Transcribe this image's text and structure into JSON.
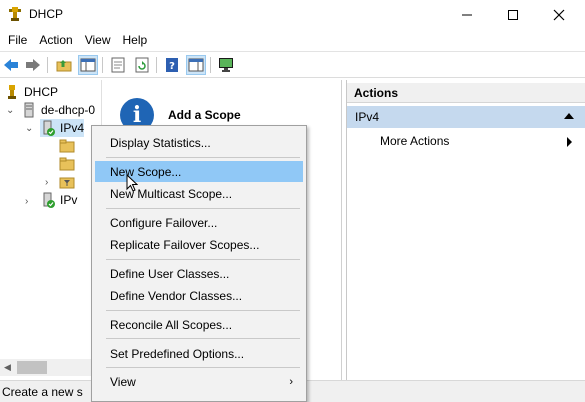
{
  "window": {
    "title": "DHCP",
    "controls": [
      "minimize-icon",
      "maximize-icon",
      "close-icon"
    ]
  },
  "menubar": {
    "items": [
      "File",
      "Action",
      "View",
      "Help"
    ]
  },
  "toolbar": {
    "buttons": [
      "back-arrow-icon",
      "forward-arrow-icon",
      "up-folder-icon",
      "show-hide-tree-icon",
      "properties-icon",
      "refresh-icon",
      "help-icon",
      "show-hide-action-pane-icon",
      "monitor-icon"
    ]
  },
  "tree": {
    "root": "DHCP",
    "server": "de-dhcp-0",
    "ipv4": "IPv4",
    "ipv6": "IPv"
  },
  "middle": {
    "title": "Add a Scope"
  },
  "actions": {
    "header": "Actions",
    "group": "IPv4",
    "item": "More Actions"
  },
  "context_menu": {
    "items": [
      "Display Statistics...",
      "New Scope...",
      "New Multicast Scope...",
      "Configure Failover...",
      "Replicate Failover Scopes...",
      "Define User Classes...",
      "Define Vendor Classes...",
      "Reconcile All Scopes...",
      "Set Predefined Options...",
      "View"
    ],
    "highlighted": "New Scope..."
  },
  "status": {
    "text": "Create a new s"
  },
  "colors": {
    "menu_highlight": "#90c8f6",
    "actions_group": "#c5d9ee",
    "info_icon": "#1f65b5"
  }
}
